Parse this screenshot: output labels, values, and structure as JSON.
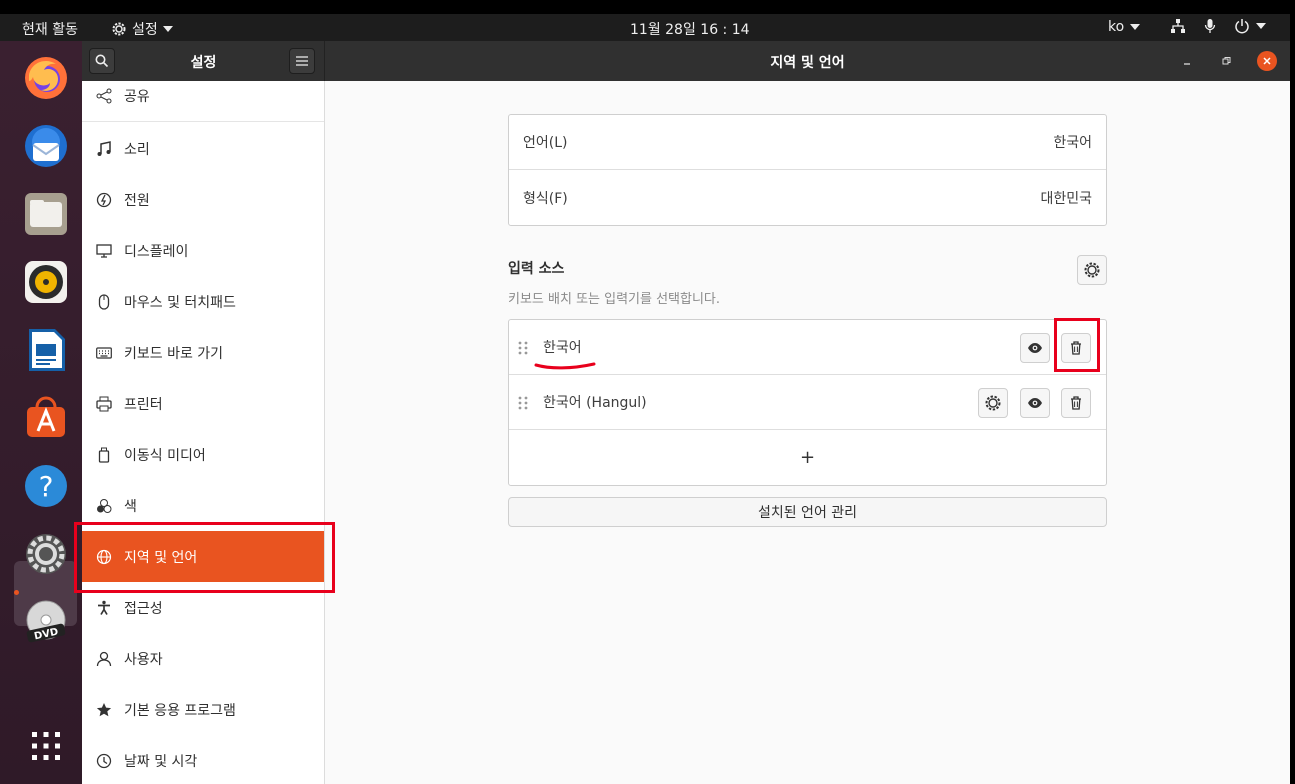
{
  "topbar": {
    "activities": "현재 활동",
    "app_menu": "설정",
    "clock": "11월 28일  16 : 14",
    "lang": "ko"
  },
  "window": {
    "sidebar_title": "설정",
    "title": "지역 및 언어"
  },
  "sidebar": {
    "items": [
      {
        "label": "공유",
        "icon": "share-icon"
      },
      {
        "label": "소리",
        "icon": "music-note-icon"
      },
      {
        "label": "전원",
        "icon": "power-icon"
      },
      {
        "label": "디스플레이",
        "icon": "display-icon"
      },
      {
        "label": "마우스 및 터치패드",
        "icon": "mouse-icon"
      },
      {
        "label": "키보드 바로 가기",
        "icon": "keyboard-icon"
      },
      {
        "label": "프린터",
        "icon": "printer-icon"
      },
      {
        "label": "이동식 미디어",
        "icon": "removable-media-icon"
      },
      {
        "label": "색",
        "icon": "color-icon"
      },
      {
        "label": "지역 및 언어",
        "icon": "globe-icon",
        "selected": true
      },
      {
        "label": "접근성",
        "icon": "accessibility-icon"
      },
      {
        "label": "사용자",
        "icon": "user-icon"
      },
      {
        "label": "기본 응용 프로그램",
        "icon": "star-icon"
      },
      {
        "label": "날짜 및 시각",
        "icon": "clock-icon"
      }
    ]
  },
  "region": {
    "language_label": "언어(L)",
    "language_value": "한국어",
    "formats_label": "형식(F)",
    "formats_value": "대한민국"
  },
  "input_sources": {
    "title": "입력 소스",
    "subtitle": "키보드 배치 또는 입력기를 선택합니다.",
    "sources": [
      "한국어",
      "한국어 (Hangul)"
    ],
    "add_label": "+"
  },
  "manage_languages_label": "설치된 언어 관리",
  "colors": {
    "accent": "#e95420",
    "annotation": "#e8001c",
    "headerbar": "#303030"
  }
}
